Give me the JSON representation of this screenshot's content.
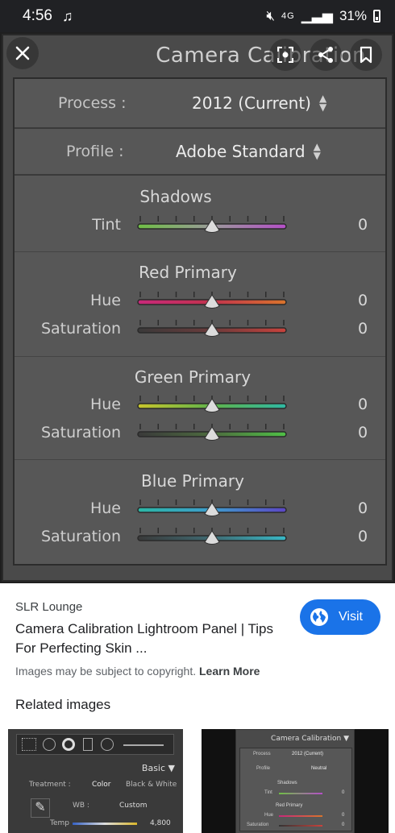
{
  "status_bar": {
    "time": "4:56",
    "network": "4G",
    "battery": "31%"
  },
  "viewer": {
    "panel_title": "Camera Calibration",
    "process_label": "Process :",
    "process_value": "2012 (Current)",
    "profile_label": "Profile :",
    "profile_value": "Adobe Standard",
    "sections": [
      {
        "title": "Shadows",
        "sliders": [
          {
            "label": "Tint",
            "value": "0"
          }
        ]
      },
      {
        "title": "Red Primary",
        "sliders": [
          {
            "label": "Hue",
            "value": "0"
          },
          {
            "label": "Saturation",
            "value": "0"
          }
        ]
      },
      {
        "title": "Green Primary",
        "sliders": [
          {
            "label": "Hue",
            "value": "0"
          },
          {
            "label": "Saturation",
            "value": "0"
          }
        ]
      },
      {
        "title": "Blue Primary",
        "sliders": [
          {
            "label": "Hue",
            "value": "0"
          },
          {
            "label": "Saturation",
            "value": "0"
          }
        ]
      }
    ]
  },
  "result": {
    "source": "SLR Lounge",
    "title": "Camera Calibration Lightroom Panel | Tips For Perfecting Skin ...",
    "copyright_text": "Images may be subject to copyright.",
    "learn_more": "Learn More",
    "visit_label": "Visit",
    "accent": "#1a73e8"
  },
  "related": {
    "heading": "Related images",
    "thumb1": {
      "basic": "Basic",
      "treatment": "Treatment :",
      "color": "Color",
      "bw": "Black & White",
      "wb": "WB :",
      "custom": "Custom",
      "temp": "Temp",
      "temp_value": "4,800"
    },
    "thumb2": {
      "title": "Camera Calibration",
      "process": "Process",
      "process_value": "2012 (Current)",
      "profile": "Profile",
      "profile_value": "Neutral",
      "shadows": "Shadows",
      "tint": "Tint",
      "red_primary": "Red Primary",
      "hue": "Hue",
      "saturation": "Saturation",
      "zero": "0"
    }
  }
}
